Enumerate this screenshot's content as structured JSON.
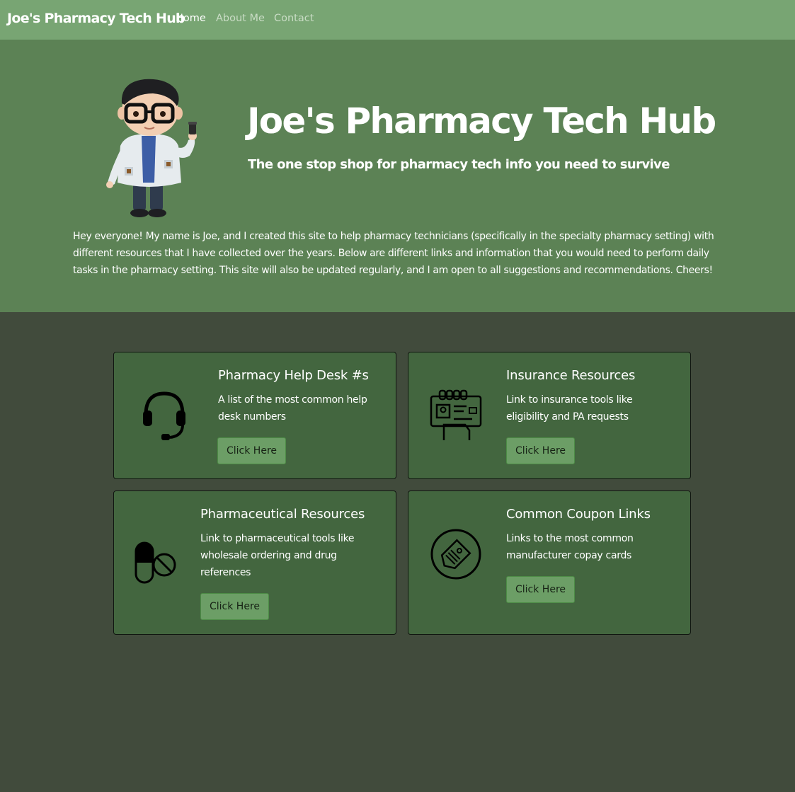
{
  "navbar": {
    "brand": "Joe's Pharmacy Tech Hub",
    "links": [
      {
        "label": "Home"
      },
      {
        "label": "About Me"
      },
      {
        "label": "Contact"
      }
    ]
  },
  "hero": {
    "title": "Joe's Pharmacy Tech Hub",
    "subtitle": "The one stop shop for pharmacy tech info you need to survive",
    "intro": "Hey everyone! My name is Joe, and I created this site to help pharmacy technicians (specifically in the specialty pharmacy setting) with different resources that I have collected over the years. Below are different links and information that you would need to perform daily tasks in the pharmacy setting. This site will also be updated regularly, and I am open to all suggestions and recommendations. Cheers!"
  },
  "cards": [
    {
      "title": "Pharmacy Help Desk #s",
      "text": "A list of the most common help desk numbers",
      "button": "Click Here",
      "icon": "headset-icon"
    },
    {
      "title": "Insurance Resources",
      "text": "Link to insurance tools like eligibility and PA requests",
      "button": "Click Here",
      "icon": "insurance-card-icon"
    },
    {
      "title": "Pharmaceutical Resources",
      "text": "Link to pharmaceutical tools like wholesale ordering and drug references",
      "button": "Click Here",
      "icon": "pill-icon"
    },
    {
      "title": "Common Coupon Links",
      "text": "Links to the most common manufacturer copay cards",
      "button": "Click Here",
      "icon": "coupon-tag-icon"
    }
  ],
  "colors": {
    "navbar": "#78a573",
    "hero": "#5c8255",
    "page": "#414b3c",
    "card": "#43663f",
    "button": "#6c9e66"
  }
}
